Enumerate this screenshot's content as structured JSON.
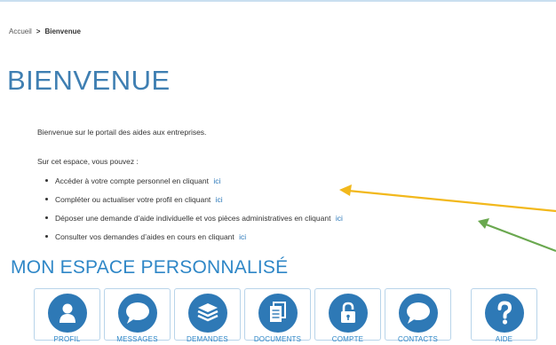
{
  "breadcrumb": {
    "home": "Accueil",
    "separator": ">",
    "current": "Bienvenue"
  },
  "page_title": "BIENVENUE",
  "intro": "Bienvenue sur le portail des aides aux entreprises.",
  "lead": "Sur cet espace, vous pouvez :",
  "actions": [
    {
      "text": "Accéder à votre compte personnel en cliquant",
      "link": "ici"
    },
    {
      "text": "Compléter ou actualiser votre profil en cliquant",
      "link": "ici"
    },
    {
      "text": "Déposer une demande d’aide individuelle et vos pièces administratives en cliquant",
      "link": "ici"
    },
    {
      "text": "Consulter vos demandes d’aides en cours en cliquant",
      "link": "ici"
    }
  ],
  "section_title": "MON ESPACE PERSONNALISÉ",
  "tiles": [
    {
      "label": "PROFIL",
      "icon": "user-icon"
    },
    {
      "label": "MESSAGES",
      "icon": "speech-bubble-icon"
    },
    {
      "label": "DEMANDES",
      "icon": "layers-stack-icon"
    },
    {
      "label": "DOCUMENTS",
      "icon": "documents-icon"
    },
    {
      "label": "COMPTE",
      "icon": "lock-icon"
    },
    {
      "label": "CONTACTS",
      "icon": "speech-bubble-icon"
    },
    {
      "label": "AIDE",
      "icon": "question-icon"
    }
  ],
  "colors": {
    "title": "#3f7fb2",
    "accent": "#2e79b6",
    "link": "#2a77b8",
    "arrow_yellow": "#f2b81c",
    "arrow_green": "#6aa84f"
  }
}
